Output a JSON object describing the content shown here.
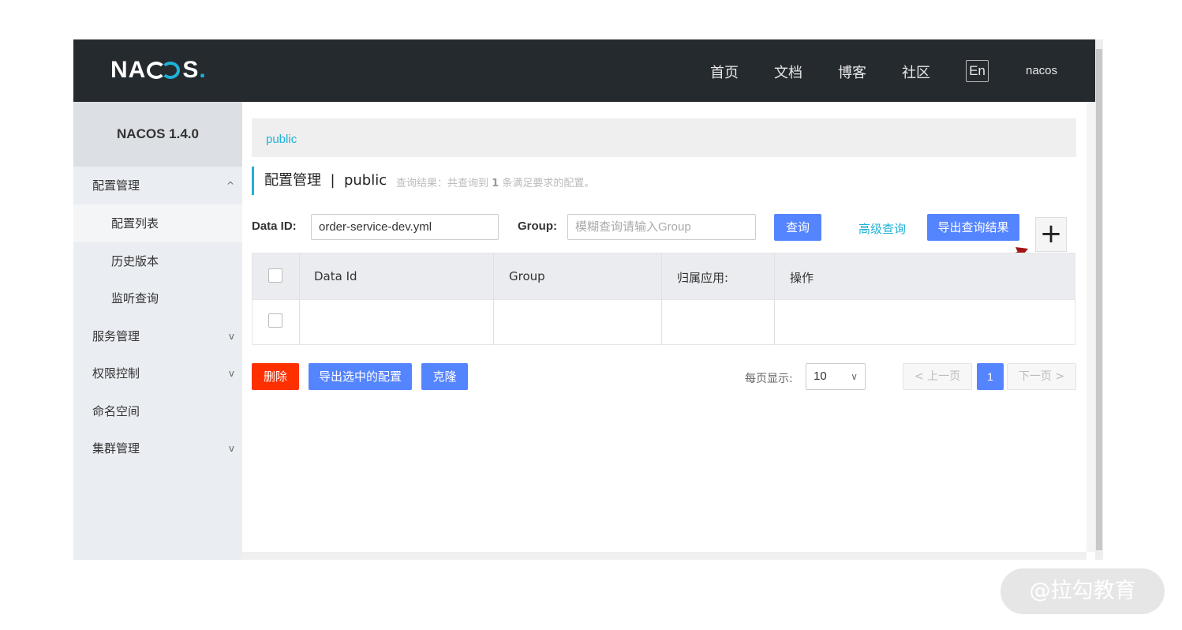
{
  "header": {
    "logo_text": "NACOS",
    "nav": [
      "首页",
      "文档",
      "博客",
      "社区"
    ],
    "lang_button": "En",
    "user": "nacos"
  },
  "sidebar": {
    "version": "NACOS 1.4.0",
    "items": [
      {
        "label": "配置管理",
        "chevron": "^"
      },
      {
        "label": "配置列表"
      },
      {
        "label": "历史版本"
      },
      {
        "label": "监听查询"
      },
      {
        "label": "服务管理",
        "chevron": "v"
      },
      {
        "label": "权限控制",
        "chevron": "v"
      },
      {
        "label": "命名空间"
      },
      {
        "label": "集群管理",
        "chevron": "v"
      }
    ]
  },
  "namespace": {
    "current": "public"
  },
  "page": {
    "title": "配置管理  |  public",
    "result_hint_prefix": "查询结果：共查询到",
    "result_count": "1",
    "result_hint_suffix": "条满足要求的配置。"
  },
  "filters": {
    "data_id_label": "Data ID:",
    "data_id_value": "order-service-dev.yml",
    "group_label": "Group:",
    "group_placeholder": "模糊查询请输入Group",
    "search_button": "查询",
    "advanced_link": "高级查询",
    "export_button": "导出查询结果",
    "add_button": "+"
  },
  "table": {
    "columns": [
      "Data Id",
      "Group",
      "归属应用:",
      "操作"
    ],
    "rows": [
      {
        "data_id": "",
        "group": "",
        "app": "",
        "ops": ""
      }
    ]
  },
  "actions": {
    "delete": "删除",
    "export_selected": "导出选中的配置",
    "clone": "克隆"
  },
  "pagination": {
    "page_size_label": "每页显示:",
    "page_size": "10",
    "prev": "上一页",
    "current": "1",
    "next": "下一页"
  },
  "watermark": "@拉勾教育",
  "colors": {
    "accent": "#1fb1d8",
    "primary_button": "#5584ff",
    "danger_button": "#ff3000",
    "annotation_arrow": "#a31515"
  }
}
